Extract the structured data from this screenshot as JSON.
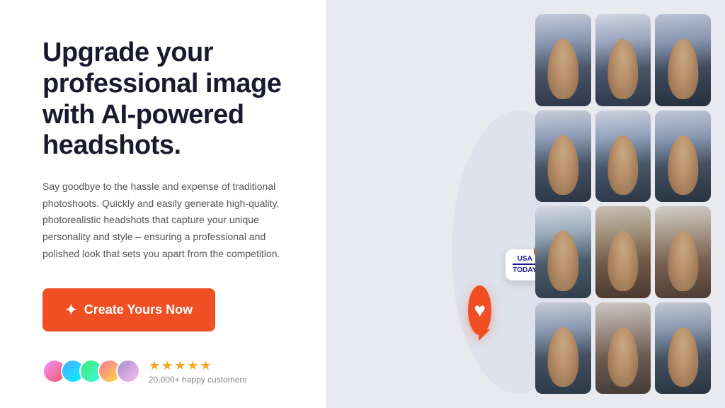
{
  "hero": {
    "headline": "Upgrade your professional image with AI-powered headshots.",
    "subtext": "Say goodbye to the hassle and expense of traditional photoshoots. Quickly and easily generate high-quality, photorealistic headshots that capture your unique personality and style – ensuring a professional and polished look that sets you apart from the competition.",
    "cta_label": "Create Yours Now",
    "review_count": "20,000+ happy customers",
    "stars": "★★★★★"
  },
  "badges": {
    "heart_icon": "♥",
    "usa_line1": "USA",
    "usa_line2": "TODAY",
    "check_icon": "✓"
  },
  "photos": [
    {
      "id": 1,
      "alt": "professional headshot 1"
    },
    {
      "id": 2,
      "alt": "professional headshot 2"
    },
    {
      "id": 3,
      "alt": "professional headshot 3"
    },
    {
      "id": 4,
      "alt": "professional headshot 4"
    },
    {
      "id": 5,
      "alt": "professional headshot 5"
    },
    {
      "id": 6,
      "alt": "professional headshot 6"
    },
    {
      "id": 7,
      "alt": "professional headshot 7"
    },
    {
      "id": 8,
      "alt": "professional headshot 8"
    },
    {
      "id": 9,
      "alt": "professional headshot 9"
    },
    {
      "id": 10,
      "alt": "professional headshot 10"
    },
    {
      "id": 11,
      "alt": "professional headshot 11"
    },
    {
      "id": 12,
      "alt": "professional headshot 12"
    }
  ]
}
